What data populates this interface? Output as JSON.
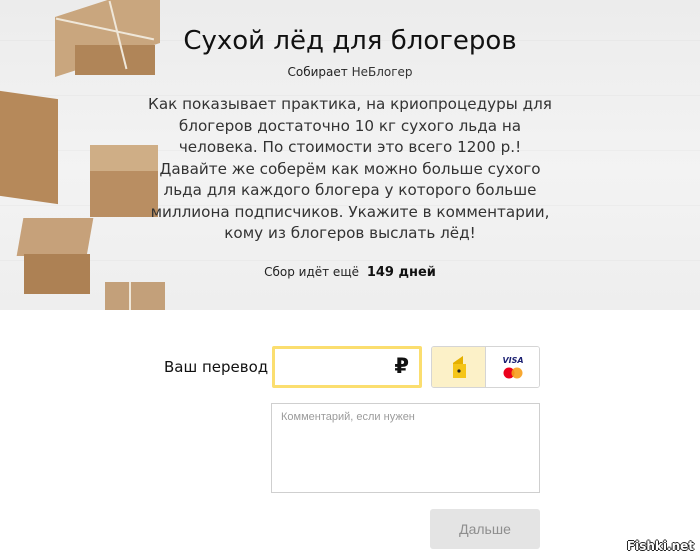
{
  "campaign": {
    "title": "Сухой лёд для блогеров",
    "author_prefix": "Собирает",
    "author_name": "НеБлогер",
    "description": "Как показывает практика, на криопроцедуры для блогеров достаточно 10 кг сухого льда на человека. По стоимости это всего 1200 р.! Давайте же соберём как можно больше сухого льда для каждого блогера у которого больше миллиона подписчиков. Укажите в комментарии, кому из блогеров выслать лёд!",
    "deadline_label": "Сбор идёт ещё",
    "deadline_value": "149 дней"
  },
  "form": {
    "amount_label": "Ваш перевод",
    "amount_value": "",
    "currency_symbol": "₽",
    "payment_methods": [
      {
        "name": "wallet",
        "icon": "yandex-money-wallet-icon",
        "selected": true,
        "color": "#fcf1c8"
      },
      {
        "name": "card",
        "icon": "visa-mastercard-icon",
        "selected": false,
        "label": "VISA"
      }
    ],
    "comment_placeholder": "Комментарий, если нужен",
    "submit_label": "Дальше"
  },
  "watermark": "Fishki.net",
  "colors": {
    "amount_border": "#fbde6f",
    "submit_bg": "#e4e4e4",
    "visa_blue": "#1a1f71",
    "mastercard_red": "#eb001b",
    "mastercard_orange": "#f79e1b"
  }
}
